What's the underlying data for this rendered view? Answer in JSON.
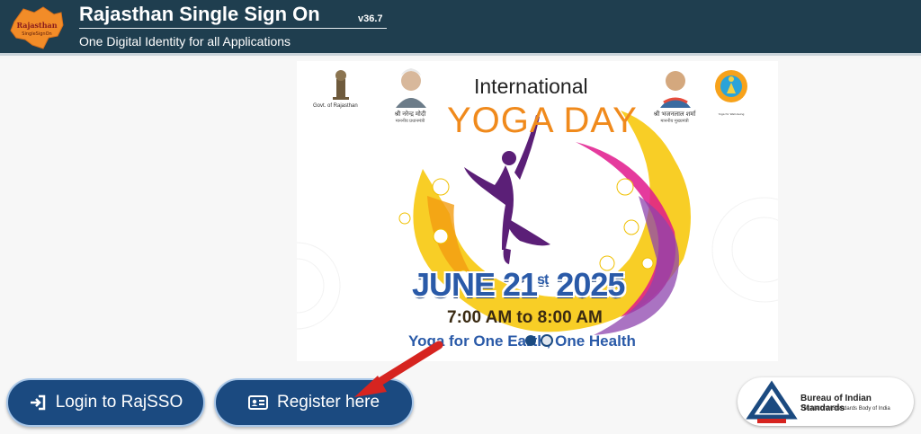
{
  "header": {
    "logo_text": "Rajasthan Single Sign On",
    "title": "Rajasthan Single Sign On",
    "version": "v36.7",
    "subtitle": "One Digital Identity for all Applications"
  },
  "banner": {
    "govt_caption": "Govt. of Rajasthan",
    "left_person_name": "श्री नरेन्द्र मोदी",
    "left_person_role": "माननीय प्रधानमंत्री",
    "right_person_name": "श्री भजनलाल शर्मा",
    "right_person_role": "माननीय मुख्यमंत्री",
    "title_line1": "International",
    "title_line2": "YOGA DAY",
    "date_main": "JUNE 21",
    "date_suffix": "st",
    "date_year": "2025",
    "time": "7:00 AM to 8:00 AM",
    "theme": "Yoga for One Earth, One Health"
  },
  "actions": {
    "login_label": "Login to RajSSO",
    "register_label": "Register here"
  },
  "bis": {
    "title": "Bureau of Indian Standards",
    "subtitle": "The National Standards Body of India"
  },
  "colors": {
    "header_bg": "#1f3e4f",
    "button_bg": "#1b4a80",
    "yoga_orange": "#f08a1c",
    "date_blue": "#2a5aa8",
    "arrow_red": "#d62420"
  },
  "icons": {
    "login": "login-arrow-icon",
    "register": "id-card-icon",
    "bis_logo": "bis-logo-icon",
    "state_logo": "rajasthan-map-logo"
  }
}
